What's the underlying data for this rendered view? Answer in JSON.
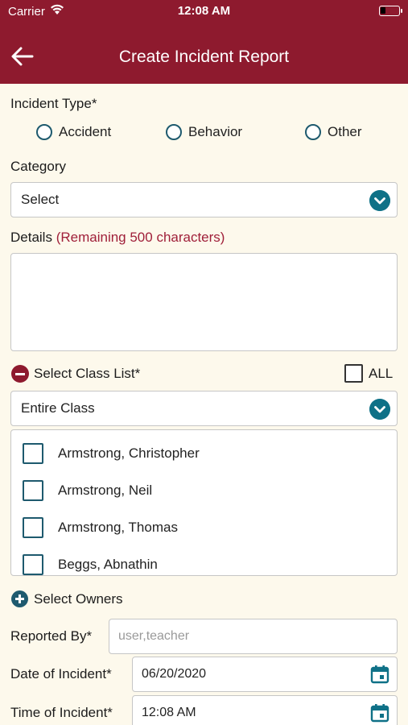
{
  "status_bar": {
    "carrier": "Carrier",
    "time": "12:08 AM"
  },
  "header": {
    "title": "Create Incident Report"
  },
  "colors": {
    "brand": "#8e1a2e",
    "accent": "#0f7187",
    "background": "#fdf9ec"
  },
  "form": {
    "incident_type_label": "Incident Type*",
    "incident_types": [
      "Accident",
      "Behavior",
      "Other"
    ],
    "category_label": "Category",
    "category_value": "Select",
    "details_label": "Details",
    "details_remaining": "(Remaining 500 characters)",
    "details_value": "",
    "class_list_label": "Select Class List*",
    "all_label": "ALL",
    "class_value": "Entire Class",
    "students": [
      "Armstrong, Christopher",
      "Armstrong, Neil",
      "Armstrong, Thomas",
      "Beggs, Abnathin"
    ],
    "select_owners_label": "Select Owners",
    "reported_by_label": "Reported By*",
    "reported_by_placeholder": "user,teacher",
    "date_label": "Date of Incident*",
    "date_value": "06/20/2020",
    "time_label": "Time of Incident*",
    "time_value": "12:08 AM"
  }
}
